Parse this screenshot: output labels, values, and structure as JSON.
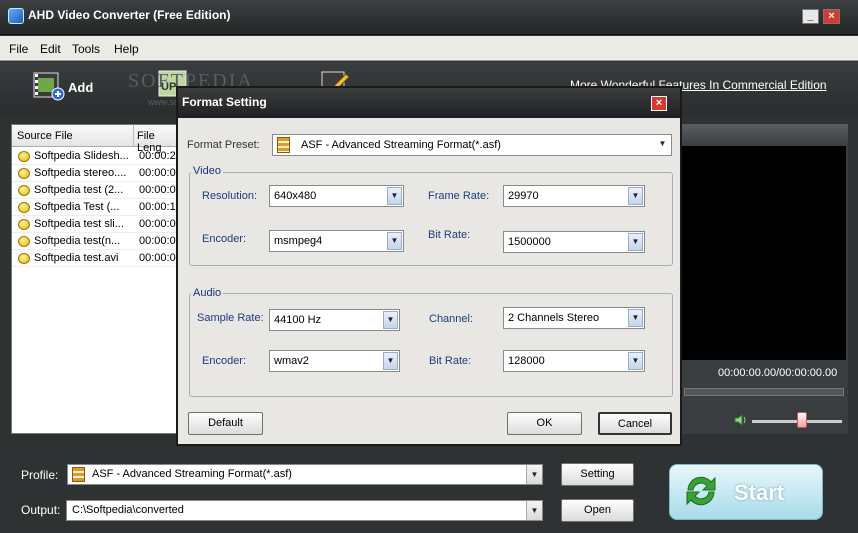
{
  "window": {
    "title": "AHD Video Converter (Free Edition)",
    "minimize_glyph": "_",
    "close_glyph": "×"
  },
  "menu": [
    "File",
    "Edit",
    "Tools",
    "Help"
  ],
  "toolbar": {
    "add_label": "Add",
    "commercial_link": "More Wonderful Features In Commercial Edition",
    "watermark": "SOFTPEDIA",
    "watermark_sub": "www.softpedia.com"
  },
  "file_list": {
    "columns": [
      "Source File",
      "File Leng"
    ],
    "rows": [
      {
        "name": "Softpedia Slidesh...",
        "length": "00:00:2"
      },
      {
        "name": "Softpedia stereo....",
        "length": "00:00:0"
      },
      {
        "name": "Softpedia test (2...",
        "length": "00:00:0"
      },
      {
        "name": "Softpedia Test (...",
        "length": "00:00:1"
      },
      {
        "name": "Softpedia test sli...",
        "length": "00:00:0"
      },
      {
        "name": "Softpedia test(n...",
        "length": "00:00:0"
      },
      {
        "name": "Softpedia test.avi",
        "length": "00:00:0"
      }
    ]
  },
  "preview": {
    "time": "00:00:00.00/00:00:00.00",
    "volume": 0.55
  },
  "dialog": {
    "title": "Format Setting",
    "close_glyph": "×",
    "preset_label": "Format Preset:",
    "preset_value": "ASF - Advanced Streaming Format(*.asf)",
    "video": {
      "label": "Video",
      "resolution_label": "Resolution:",
      "resolution": "640x480",
      "frame_rate_label": "Frame Rate:",
      "frame_rate": "29970",
      "encoder_label": "Encoder:",
      "encoder": "msmpeg4",
      "bit_rate_label": "Bit Rate:",
      "bit_rate": "1500000"
    },
    "audio": {
      "label": "Audio",
      "sample_rate_label": "Sample Rate:",
      "sample_rate": "44100 Hz",
      "channel_label": "Channel:",
      "channel": "2 Channels Stereo",
      "encoder_label": "Encoder:",
      "encoder": "wmav2",
      "bit_rate_label": "Bit Rate:",
      "bit_rate": "128000"
    },
    "default_button": "Default",
    "ok_button": "OK",
    "cancel_button": "Cancel"
  },
  "bottom": {
    "profile_label": "Profile:",
    "profile_value": "ASF - Advanced Streaming Format(*.asf)",
    "setting_button": "Setting",
    "output_label": "Output:",
    "output_value": "C:\\Softpedia\\converted",
    "open_button": "Open",
    "start_button": "Start"
  },
  "colors": {
    "accent": "#1c3c80",
    "close": "#d63a2a",
    "start": "#a8dbe9"
  },
  "icons": [
    "app-icon",
    "add-video-icon",
    "upload-icon",
    "edit-icon",
    "file-status-icon",
    "volume-icon",
    "format-icon",
    "refresh-icon",
    "dropdown-arrow-icon"
  ]
}
